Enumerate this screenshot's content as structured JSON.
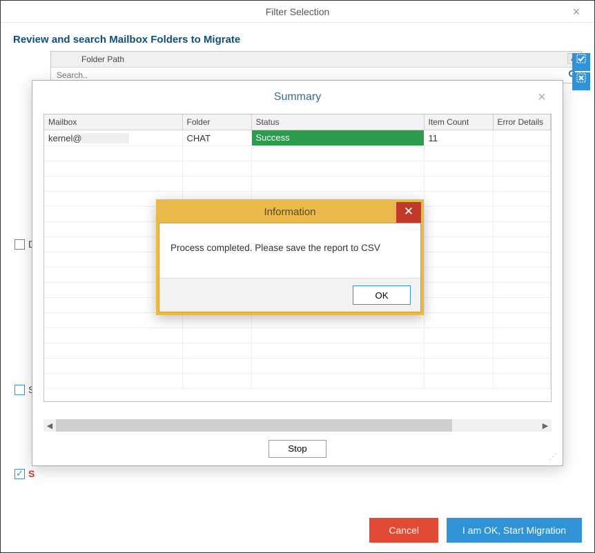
{
  "window": {
    "title": "Filter Selection",
    "subheading": "Review and search Mailbox Folders to Migrate",
    "folder_path_label": "Folder Path",
    "search_placeholder": "Search..",
    "bg_d_label": "D",
    "bg_s_label": "S",
    "bg_skip_label": "S"
  },
  "footer": {
    "cancel": "Cancel",
    "start": "I am OK, Start Migration"
  },
  "summary": {
    "title": "Summary",
    "columns": {
      "mailbox": "Mailbox",
      "folder": "Folder",
      "status": "Status",
      "count": "Item Count",
      "error": "Error Details"
    },
    "rows": [
      {
        "mailbox": "kernel@",
        "folder": "CHAT",
        "status": "Success",
        "count": "11",
        "error": ""
      }
    ],
    "stop": "Stop"
  },
  "info": {
    "title": "Information",
    "message": "Process completed. Please save the report to CSV",
    "ok": "OK"
  },
  "colors": {
    "accent": "#2f93d6",
    "danger": "#e14a34",
    "success": "#2a9c4c",
    "popup_chrome": "#e9b94b"
  }
}
